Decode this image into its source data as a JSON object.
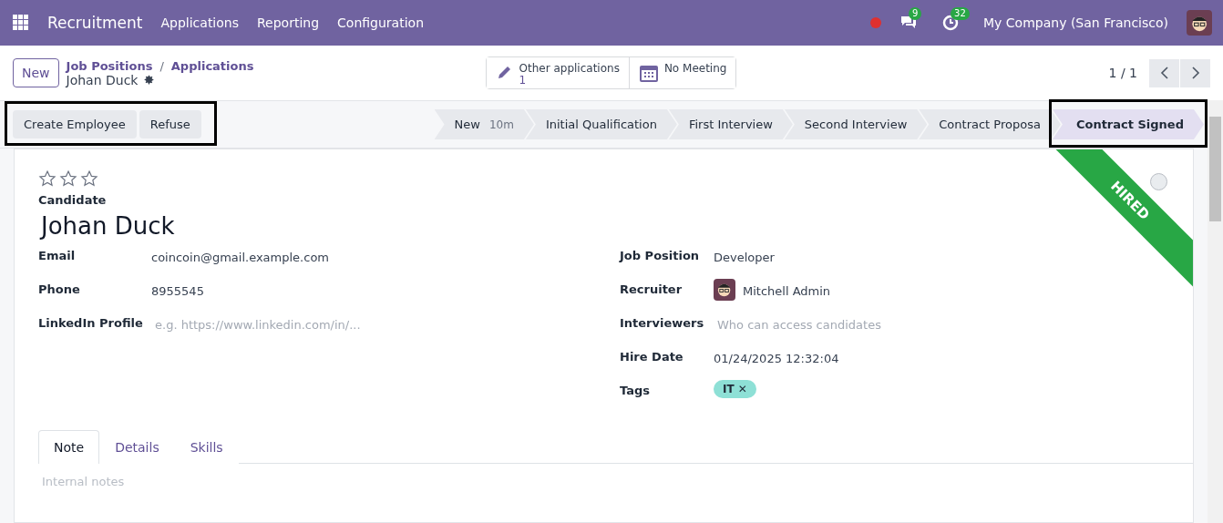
{
  "navbar": {
    "app": "Recruitment",
    "menus": [
      "Applications",
      "Reporting",
      "Configuration"
    ],
    "messages_count": "9",
    "activities_count": "32",
    "company": "My Company (San Francisco)"
  },
  "control_panel": {
    "new_button": "New",
    "breadcrumbs": [
      "Job Positions",
      "Applications"
    ],
    "breadcrumb_separator": "/",
    "record": "Johan Duck",
    "smart_buttons": [
      {
        "kind": "pencil",
        "label": "Other applications",
        "value": "1"
      },
      {
        "kind": "calendar",
        "label": "No Meeting"
      }
    ],
    "pager": "1 / 1"
  },
  "actions": [
    "Create Employee",
    "Refuse"
  ],
  "stages": [
    {
      "label": "New",
      "duration": "10m",
      "selected": false
    },
    {
      "label": "Initial Qualification",
      "selected": false
    },
    {
      "label": "First Interview",
      "selected": false
    },
    {
      "label": "Second Interview",
      "selected": false
    },
    {
      "label": "Contract Proposa",
      "selected": false
    },
    {
      "label": "Contract Signed",
      "selected": true
    }
  ],
  "ribbon": "HIRED",
  "form": {
    "stars": 0,
    "candidate_label": "Candidate",
    "candidate_name": "Johan Duck",
    "left_fields": [
      {
        "label": "Email",
        "kind": "text",
        "value": "coincoin@gmail.example.com"
      },
      {
        "label": "Phone",
        "kind": "text",
        "value": "8955545"
      },
      {
        "label": "LinkedIn Profile",
        "kind": "placeholder",
        "placeholder": "e.g. https://www.linkedin.com/in/..."
      }
    ],
    "right_fields": [
      {
        "label": "Job Position",
        "kind": "text",
        "value": "Developer"
      },
      {
        "label": "Recruiter",
        "kind": "avatar",
        "value": "Mitchell Admin"
      },
      {
        "label": "Interviewers",
        "kind": "placeholder",
        "placeholder": "Who can access candidates"
      },
      {
        "label": "Hire Date",
        "kind": "text",
        "value": "01/24/2025 12:32:04"
      },
      {
        "label": "Tags",
        "kind": "tags",
        "tags": [
          {
            "label": "IT",
            "color": "#8ee0d6",
            "remove": "✕"
          }
        ]
      }
    ],
    "tabs": [
      {
        "label": "Note",
        "selected": true
      },
      {
        "label": "Details",
        "selected": false
      },
      {
        "label": "Skills",
        "selected": false
      }
    ],
    "note_placeholder": "Internal notes"
  }
}
